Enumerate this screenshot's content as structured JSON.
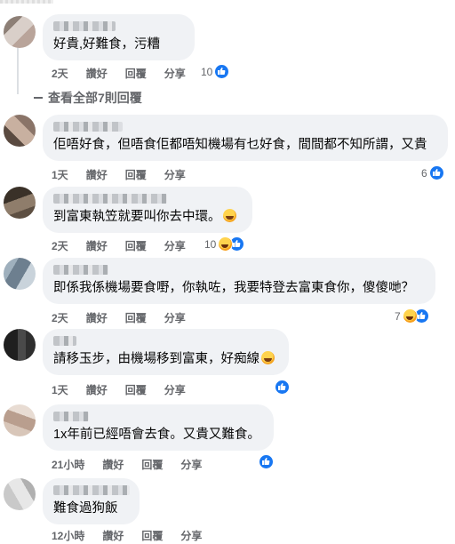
{
  "comments": [
    {
      "text": "好貴,好難食，污糟",
      "actions": [
        "2天",
        "讚好",
        "回覆",
        "分享"
      ],
      "reaction_count": "10",
      "reactions": [
        "like"
      ]
    },
    {
      "text": "佢唔好食，但唔食佢都唔知機場有乜好食，間間都不知所謂，又貴",
      "actions": [
        "1天",
        "讚好",
        "回覆",
        "分享"
      ],
      "reaction_count": "6",
      "reactions": [
        "like"
      ]
    },
    {
      "text": "到富東執笠就要叫你去中環。",
      "actions": [
        "2天",
        "讚好",
        "回覆",
        "分享"
      ],
      "reaction_count": "10",
      "reactions": [
        "haha",
        "like"
      ]
    },
    {
      "text": "即係我係機場要食嘢，你執咗，我要特登去富東食你，傻傻哋？",
      "actions": [
        "2天",
        "讚好",
        "回覆",
        "分享"
      ],
      "reaction_count": "7",
      "reactions": [
        "haha",
        "like"
      ]
    },
    {
      "text": "請移玉步，由機場移到富東，好痴線",
      "actions": [
        "1天",
        "讚好",
        "回覆",
        "分享"
      ],
      "reaction_count": "",
      "reactions": [
        "like"
      ]
    },
    {
      "text": "1x年前已經唔會去食。又貴又難食。",
      "actions": [
        "21小時",
        "讚好",
        "回覆",
        "分享"
      ],
      "reaction_count": "",
      "reactions": [
        "like"
      ]
    },
    {
      "text": "難食過狗飯",
      "actions": [
        "12小時",
        "讚好",
        "回覆",
        "分享"
      ],
      "reaction_count": "",
      "reactions": []
    }
  ],
  "view_all_replies": "查看全部7則回覆",
  "colors": {
    "bubble": "#f0f2f5",
    "meta_text": "#65676b",
    "like_blue": "#1877f2"
  }
}
